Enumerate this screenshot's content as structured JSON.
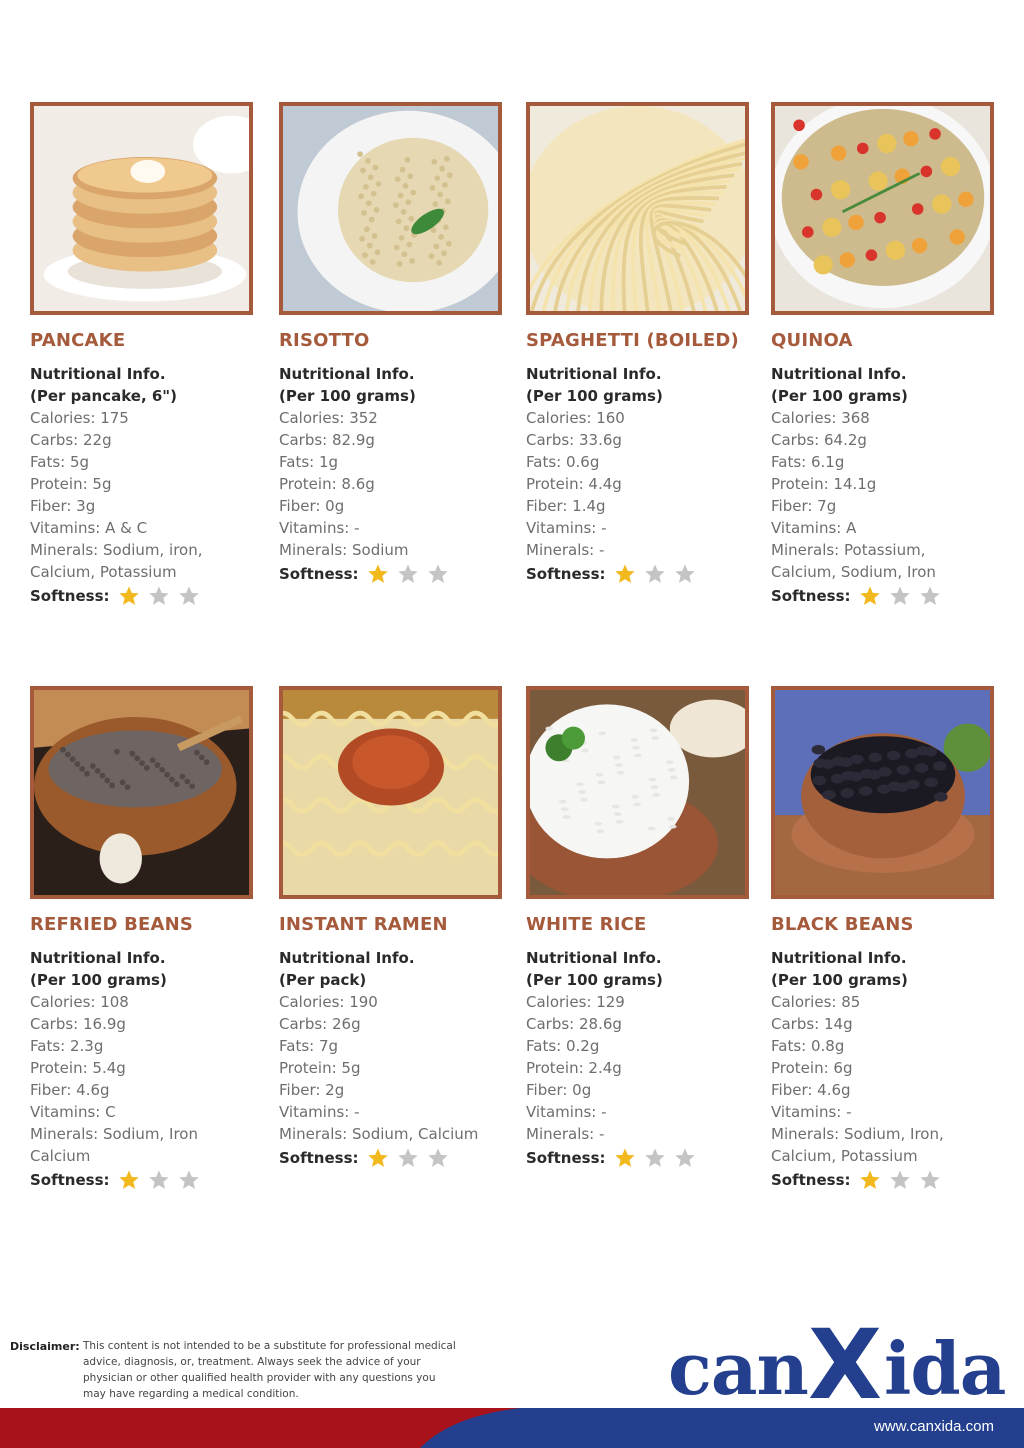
{
  "foods": [
    {
      "name": "PANCAKE",
      "info": "Nutritional Info.",
      "per": "(Per pancake, 6\")",
      "rows": [
        "Calories: 175",
        "Carbs: 22g",
        "Fats: 5g",
        "Protein: 5g",
        "Fiber: 3g",
        "Vitamins: A & C",
        "Minerals: Sodium, iron,",
        "Calcium, Potassium"
      ],
      "softness_label": "Softness:",
      "softness": 1,
      "max_softness": 3,
      "photo": "pancake-stack-photo"
    },
    {
      "name": "RISOTTO",
      "info": "Nutritional Info.",
      "per": "(Per 100 grams)",
      "rows": [
        "Calories: 352",
        "Carbs: 82.9g",
        "Fats: 1g",
        "Protein: 8.6g",
        "Fiber: 0g",
        "Vitamins: -",
        "Minerals: Sodium"
      ],
      "softness_label": "Softness:",
      "softness": 1,
      "max_softness": 3,
      "photo": "risotto-plate-photo"
    },
    {
      "name": "SPAGHETTI (BOILED)",
      "info": "Nutritional Info.",
      "per": "(Per 100 grams)",
      "rows": [
        "Calories: 160",
        "Carbs: 33.6g",
        "Fats: 0.6g",
        "Protein: 4.4g",
        "Fiber: 1.4g",
        "Vitamins: -",
        "Minerals: -"
      ],
      "softness_label": "Softness:",
      "softness": 1,
      "max_softness": 3,
      "photo": "spaghetti-photo"
    },
    {
      "name": "QUINOA",
      "info": "Nutritional Info.",
      "per": "(Per 100 grams)",
      "rows": [
        "Calories: 368",
        "Carbs: 64.2g",
        "Fats: 6.1g",
        "Protein: 14.1g",
        "Fiber: 7g",
        "Vitamins: A",
        "Minerals: Potassium,",
        "Calcium, Sodium, Iron"
      ],
      "softness_label": "Softness:",
      "softness": 1,
      "max_softness": 3,
      "photo": "quinoa-salad-photo"
    },
    {
      "name": "REFRIED BEANS",
      "info": "Nutritional Info.",
      "per": "(Per 100 grams)",
      "rows": [
        "Calories: 108",
        "Carbs: 16.9g",
        "Fats: 2.3g",
        "Protein: 5.4g",
        "Fiber: 4.6g",
        "Vitamins: C",
        "Minerals: Sodium, Iron",
        "Calcium"
      ],
      "softness_label": "Softness:",
      "softness": 1,
      "max_softness": 3,
      "photo": "refried-beans-bowl-photo"
    },
    {
      "name": "INSTANT RAMEN",
      "info": "Nutritional Info.",
      "per": "(Per pack)",
      "rows": [
        "Calories: 190",
        "Carbs: 26g",
        "Fats: 7g",
        "Protein: 5g",
        "Fiber: 2g",
        "Vitamins: -",
        "Minerals: Sodium, Calcium"
      ],
      "softness_label": "Softness:",
      "softness": 1,
      "max_softness": 3,
      "photo": "instant-ramen-photo"
    },
    {
      "name": "WHITE RICE",
      "info": "Nutritional Info.",
      "per": "(Per 100 grams)",
      "rows": [
        "Calories: 129",
        "Carbs: 28.6g",
        "Fats: 0.2g",
        "Protein: 2.4g",
        "Fiber: 0g",
        "Vitamins: -",
        "Minerals: -"
      ],
      "softness_label": "Softness:",
      "softness": 1,
      "max_softness": 3,
      "photo": "white-rice-bowl-photo"
    },
    {
      "name": "BLACK BEANS",
      "info": "Nutritional Info.",
      "per": "(Per 100 grams)",
      "rows": [
        "Calories: 85",
        "Carbs: 14g",
        "Fats: 0.8g",
        "Protein: 6g",
        "Fiber: 4.6g",
        "Vitamins: -",
        "Minerals: Sodium, Iron,",
        "Calcium, Potassium"
      ],
      "softness_label": "Softness:",
      "softness": 1,
      "max_softness": 3,
      "photo": "black-beans-bowl-photo"
    }
  ],
  "disclaimer": {
    "label": "Disclaimer:",
    "text": "This content is not intended to be a substitute for professional medical advice, diagnosis, or, treatment. Always seek the advice of your physician or other qualified health provider with any questions you may have regarding a medical condition."
  },
  "brand": {
    "logo_text": "canXida",
    "url": "www.canxida.com"
  },
  "colors": {
    "accent": "#a55a3c",
    "star_on": "#f2b91e",
    "star_off": "#c4c4c4",
    "brand_blue": "#233f8e",
    "brand_red": "#a8121a"
  }
}
